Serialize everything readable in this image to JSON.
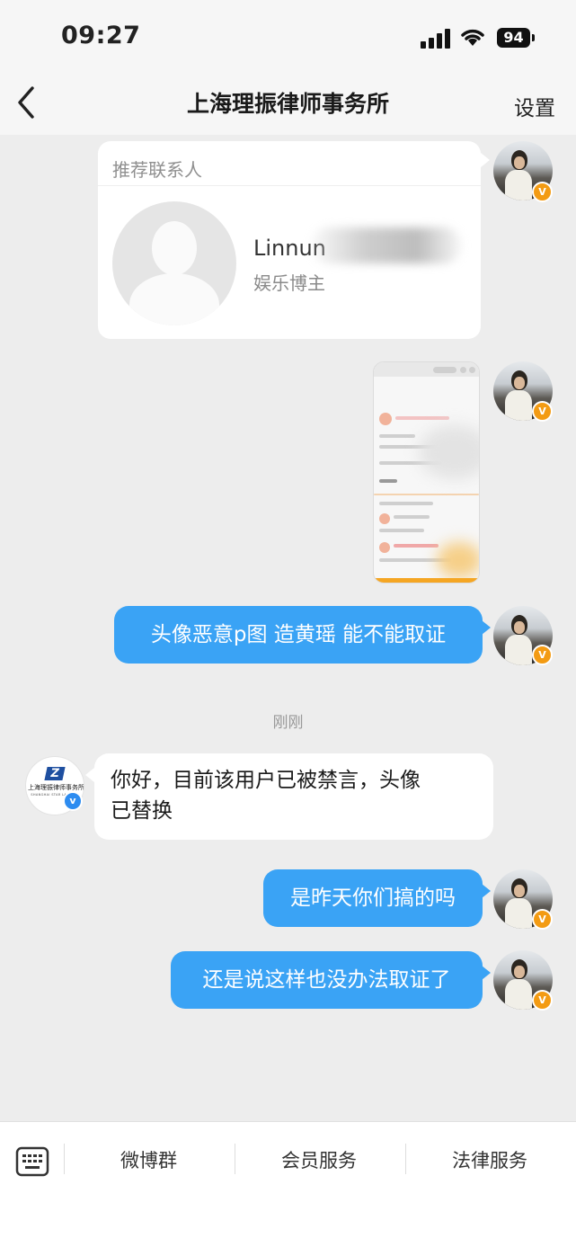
{
  "status_bar": {
    "time": "09:27",
    "battery": "94"
  },
  "header": {
    "title": "上海理振律师事务所",
    "settings_label": "设置"
  },
  "contact_card": {
    "heading": "推荐联系人",
    "name": "Linnun",
    "description": "娱乐博主"
  },
  "messages": [
    {
      "from": "me",
      "type": "contact_card"
    },
    {
      "from": "me",
      "type": "image"
    },
    {
      "from": "me",
      "type": "text",
      "text": "头像恶意p图 造黄瑶 能不能取证"
    },
    {
      "from": "them",
      "type": "text",
      "text_line1": "你好，目前该用户已被禁言，头像",
      "text_line2": "已替换"
    },
    {
      "from": "me",
      "type": "text",
      "text": "是昨天你们搞的吗"
    },
    {
      "from": "me",
      "type": "text",
      "text": "还是说这样也没办法取证了"
    }
  ],
  "timestamp": "刚刚",
  "law_firm_logo": {
    "name": "上海理振律师事务所",
    "sub": "SHANGHAI STAR LAWFIRM"
  },
  "bottom_menu": {
    "items": [
      "微博群",
      "会员服务",
      "法律服务"
    ]
  },
  "colors": {
    "my_bubble": "#3aa3f5",
    "background": "#ededed",
    "vip_badge": "#f39b13",
    "verified_badge": "#2d8cf0"
  }
}
